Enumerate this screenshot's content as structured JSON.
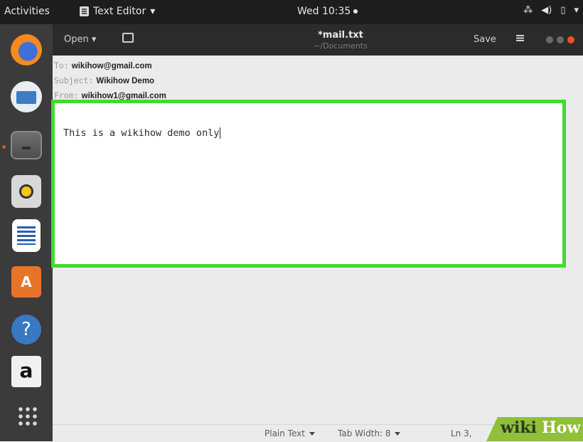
{
  "topbar": {
    "activities": "Activities",
    "app_name": "Text Editor",
    "clock": "Wed 10:35"
  },
  "dock": {
    "items": [
      "firefox-icon",
      "thunderbird-mail-icon",
      "files-icon",
      "rhythmbox-icon",
      "libreoffice-writer-icon",
      "ubuntu-software-icon",
      "help-icon",
      "amazon-icon",
      "show-applications-icon"
    ],
    "software_glyph": "A",
    "help_glyph": "?",
    "amazon_glyph": "a"
  },
  "header": {
    "open_label": "Open",
    "title": "*mail.txt",
    "subtitle": "~/Documents",
    "save_label": "Save"
  },
  "email": {
    "to_key": "To:",
    "to_value": "wikihow@gmail.com",
    "subject_key": "Subject:",
    "subject_value": "Wikihow Demo",
    "from_key": "From:",
    "from_value": "wikihow1@gmail.com",
    "body": "This is a wikihow demo only"
  },
  "statusbar": {
    "syntax": "Plain Text",
    "tab_width": "Tab Width: 8",
    "position": "Ln 3,"
  },
  "watermark": {
    "part1": "wiki",
    "part2": "How"
  },
  "colors": {
    "highlight_border": "#3fdc2e",
    "close_button": "#e95420",
    "topbar_bg": "#1d1d1d",
    "dock_bg": "#3b3b3b"
  }
}
